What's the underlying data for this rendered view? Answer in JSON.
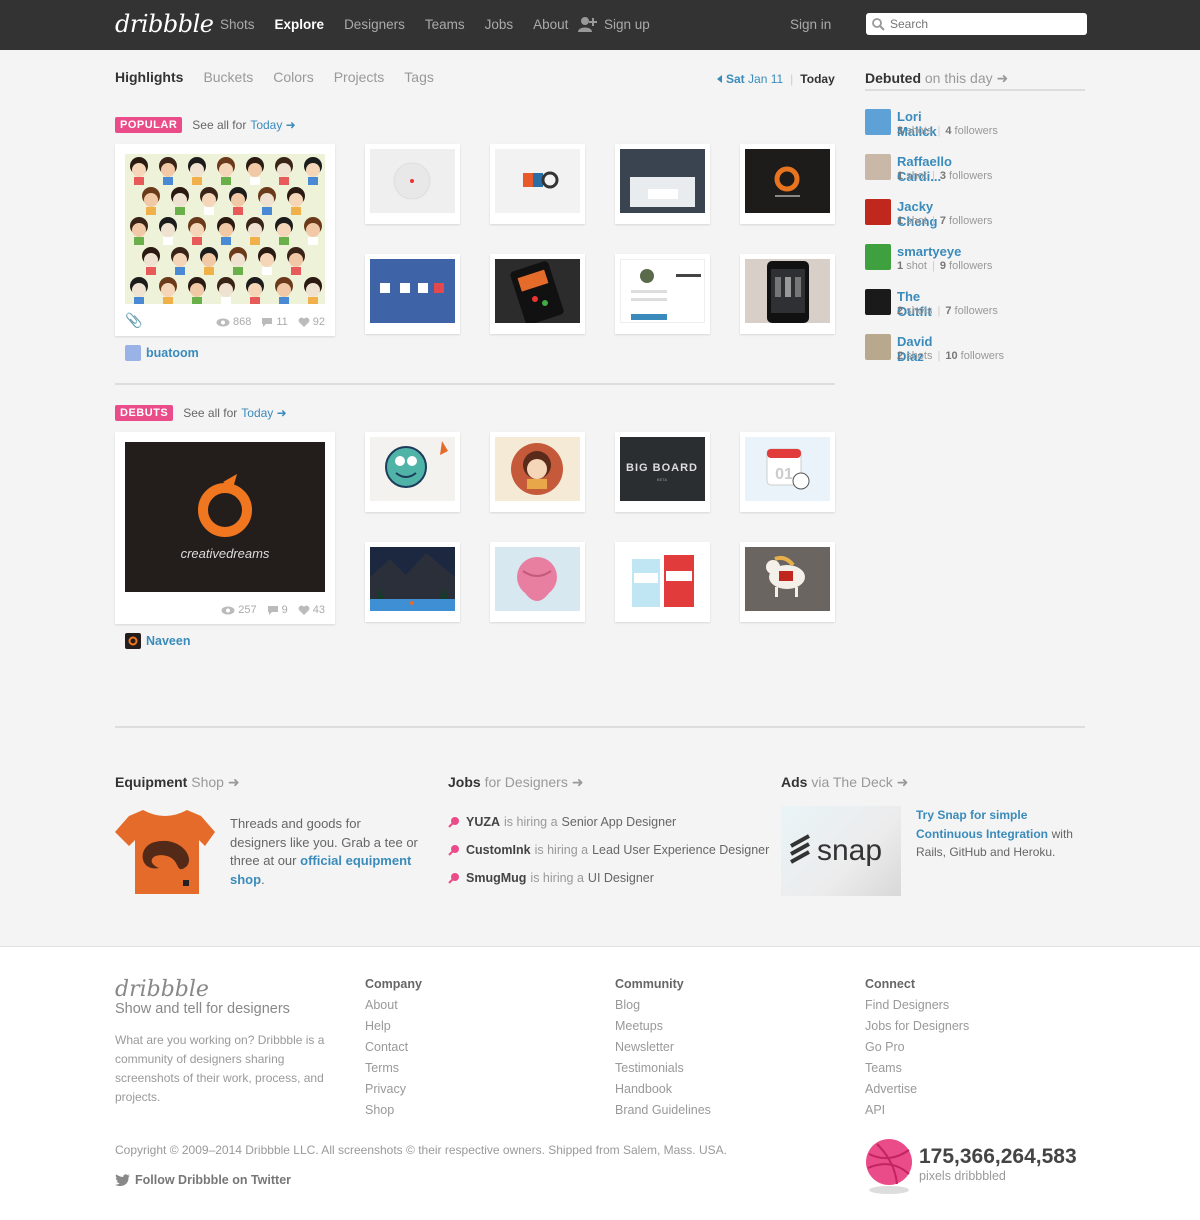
{
  "header": {
    "logo": "dribbble",
    "nav": [
      "Shots",
      "Explore",
      "Designers",
      "Teams",
      "Jobs",
      "About"
    ],
    "active_nav": "Explore",
    "signup": "Sign up",
    "signin": "Sign in",
    "search_placeholder": "Search"
  },
  "subtabs": [
    "Highlights",
    "Buckets",
    "Colors",
    "Projects",
    "Tags"
  ],
  "datenav": {
    "prev_day": "Sat",
    "prev_date": "Jan 11",
    "today": "Today"
  },
  "popular": {
    "badge": "POPULAR",
    "see_all": "See all for",
    "today_link": "Today",
    "featured": {
      "views": "868",
      "comments": "11",
      "likes": "92",
      "author": "buatoom"
    }
  },
  "debuts": {
    "badge": "DEBUTS",
    "see_all": "See all for",
    "today_link": "Today",
    "featured": {
      "views": "257",
      "comments": "9",
      "likes": "43",
      "author": "Naveen",
      "image_text": "creativedreams"
    }
  },
  "thumb_texts": {
    "bigboard": "BIG BOARD",
    "bigboard_sub": "BETA",
    "calendar": "01"
  },
  "sidebar": {
    "title": "Debuted",
    "title_suffix": "on this day",
    "users": [
      {
        "name": "Lori Malick",
        "shots": "3",
        "shots_label": "shots",
        "followers": "4",
        "followers_label": "followers",
        "color": "#5da1d6"
      },
      {
        "name": "Raffaello Cardi...",
        "shots": "1",
        "shots_label": "shot",
        "followers": "3",
        "followers_label": "followers",
        "color": "#c9b8a8"
      },
      {
        "name": "Jacky Cheng",
        "shots": "1",
        "shots_label": "shot",
        "followers": "7",
        "followers_label": "followers",
        "color": "#c0281e"
      },
      {
        "name": "smartyeye",
        "shots": "1",
        "shots_label": "shot",
        "followers": "9",
        "followers_label": "followers",
        "color": "#3fa040"
      },
      {
        "name": "The Outfit",
        "shots": "2",
        "shots_label": "shots",
        "followers": "7",
        "followers_label": "followers",
        "color": "#1a1a1a"
      },
      {
        "name": "David Diaz",
        "shots": "2",
        "shots_label": "shots",
        "followers": "10",
        "followers_label": "followers",
        "color": "#b7a88e"
      }
    ]
  },
  "equipment": {
    "title": "Equipment",
    "title_suffix": "Shop",
    "text": "Threads and goods for designers like you. Grab a tee or three at our",
    "link": "official equipment shop",
    "after": "."
  },
  "jobs": {
    "title": "Jobs",
    "title_suffix": "for Designers",
    "hiring": "is hiring a",
    "items": [
      {
        "company": "YUZA",
        "role": "Senior App Designer"
      },
      {
        "company": "CustomInk",
        "role": "Lead User Experience Designer"
      },
      {
        "company": "SmugMug",
        "role": "UI Designer"
      }
    ]
  },
  "ads": {
    "title": "Ads",
    "title_suffix": "via The Deck",
    "link": "Try Snap for simple Continuous Integration",
    "text": "with Rails, GitHub and Heroku.",
    "image_text": "snap"
  },
  "footer": {
    "logo": "dribbble",
    "tagline": "Show and tell for designers",
    "description": "What are you working on? Dribbble is a community of designers sharing screenshots of their work, process, and projects.",
    "columns": [
      {
        "heading": "Company",
        "links": [
          "About",
          "Help",
          "Contact",
          "Terms",
          "Privacy",
          "Shop"
        ]
      },
      {
        "heading": "Community",
        "links": [
          "Blog",
          "Meetups",
          "Newsletter",
          "Testimonials",
          "Handbook",
          "Brand Guidelines"
        ]
      },
      {
        "heading": "Connect",
        "links": [
          "Find Designers",
          "Jobs for Designers",
          "Go Pro",
          "Teams",
          "Advertise",
          "API"
        ]
      }
    ],
    "copyright": "Copyright © 2009–2014 Dribbble LLC. All screenshots © their respective owners. Shipped from Salem, Mass. USA.",
    "twitter": "Follow Dribbble on Twitter",
    "pixel_count": "175,366,264,583",
    "pixel_label": "pixels dribbbled"
  },
  "colors": {
    "accent_pink": "#ea4c89",
    "link_blue": "#3a8bbb",
    "header_bg": "#333333"
  }
}
